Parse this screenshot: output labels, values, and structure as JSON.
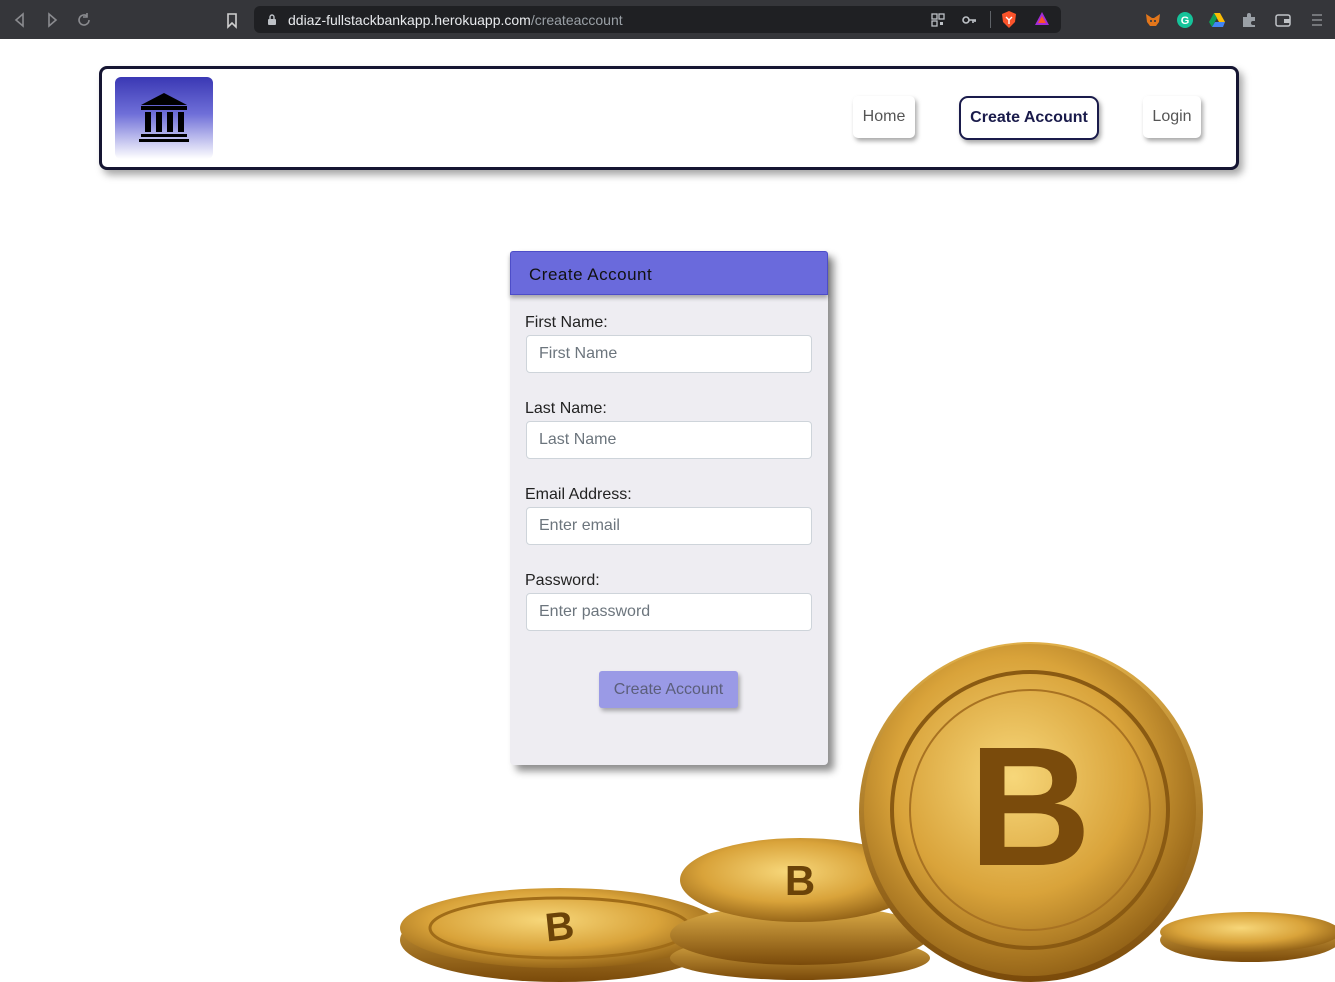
{
  "browser": {
    "url_host": "ddiaz-fullstackbankapp.herokuapp.com",
    "url_path": "/createaccount"
  },
  "nav": {
    "logo_icon": "bank-icon",
    "home": "Home",
    "create_account": "Create Account",
    "login": "Login"
  },
  "form": {
    "header": "Create Account",
    "first_name_label": "First Name:",
    "first_name_placeholder": "First Name",
    "last_name_label": "Last Name:",
    "last_name_placeholder": "Last Name",
    "email_label": "Email Address:",
    "email_placeholder": "Enter email",
    "password_label": "Password:",
    "password_placeholder": "Enter password",
    "submit": "Create Account"
  },
  "colors": {
    "accent": "#6a6adc",
    "nav_border": "#151532"
  }
}
